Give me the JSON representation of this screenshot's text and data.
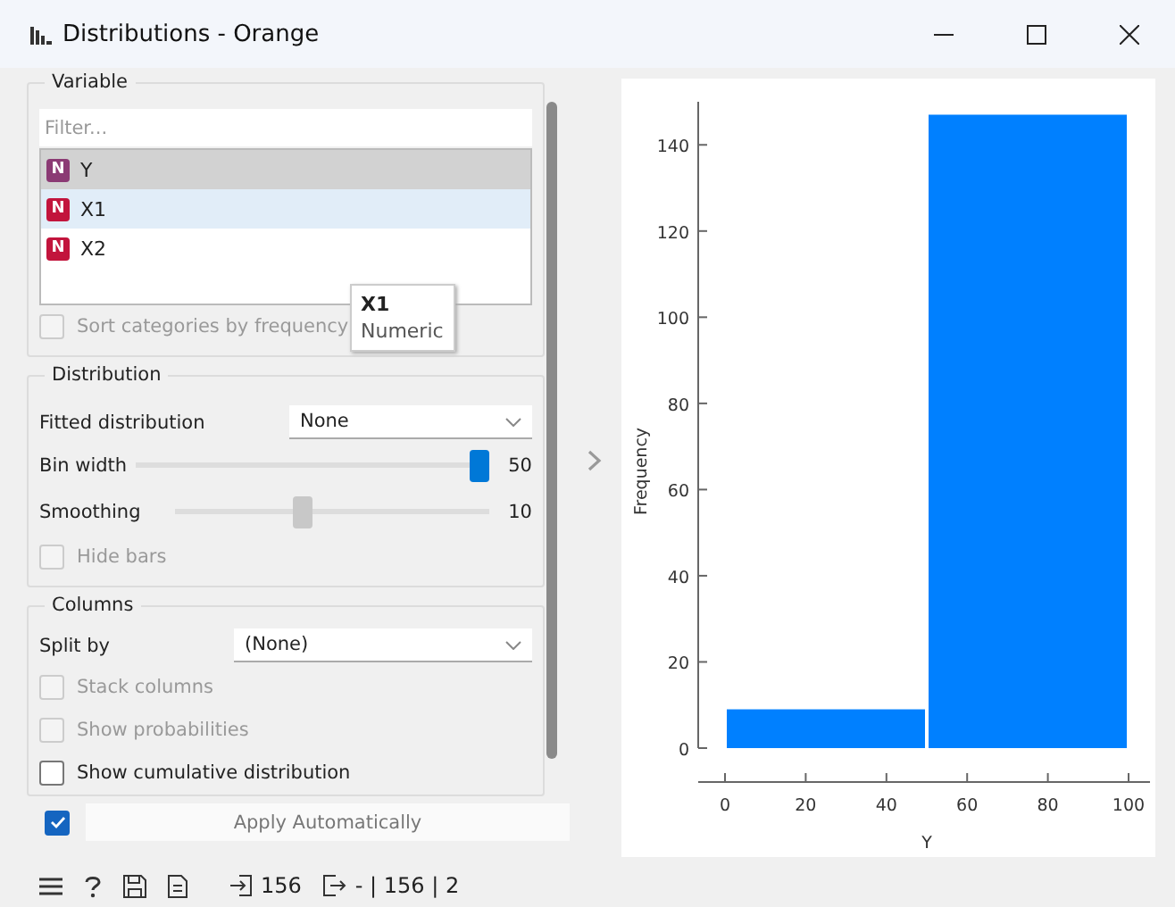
{
  "window": {
    "title": "Distributions - Orange"
  },
  "variable": {
    "title": "Variable",
    "filter": {
      "placeholder": "Filter..."
    },
    "items": [
      {
        "badge": "N",
        "name": "Y",
        "selected": true,
        "hovered": false,
        "color": "#8b3a74"
      },
      {
        "badge": "N",
        "name": "X1",
        "selected": false,
        "hovered": true,
        "color": "#c2143c"
      },
      {
        "badge": "N",
        "name": "X2",
        "selected": false,
        "hovered": false,
        "color": "#c2143c"
      }
    ],
    "tooltip": {
      "title": "X1",
      "subtitle": "Numeric"
    },
    "sort_checkbox": {
      "label": "Sort categories by frequency",
      "checked": false,
      "disabled": true
    }
  },
  "distribution": {
    "title": "Distribution",
    "fitted": {
      "label": "Fitted distribution",
      "value": "None"
    },
    "sliders": [
      {
        "label": "Bin width",
        "level": 1.0,
        "reading": "50",
        "active": true
      },
      {
        "label": "Smoothing",
        "level": 0.4,
        "reading": "10",
        "active": false
      }
    ],
    "hide_bars": {
      "label": "Hide bars",
      "checked": false,
      "disabled": true
    }
  },
  "columns": {
    "title": "Columns",
    "split_by": {
      "label": "Split by",
      "value": "(None)"
    },
    "checkboxes": [
      {
        "label": "Stack columns",
        "checked": false,
        "disabled": true
      },
      {
        "label": "Show probabilities",
        "checked": false,
        "disabled": true
      },
      {
        "label": "Show cumulative distribution",
        "checked": false,
        "disabled": false
      }
    ]
  },
  "apply": {
    "checked": true,
    "label": "Apply Automatically"
  },
  "chart": {
    "chart_data": {
      "type": "bar",
      "xlabel": "Y",
      "ylabel": "Frequency",
      "x": [
        25,
        75
      ],
      "values": [
        9,
        147
      ],
      "xlim": [
        0,
        100
      ],
      "ylim": [
        0,
        150
      ],
      "xticks": [
        0,
        20,
        40,
        60,
        80,
        100
      ],
      "yticks": [
        0,
        20,
        40,
        60,
        80,
        100,
        120,
        140
      ]
    }
  },
  "status_bar": {
    "input_count": "156",
    "output_text": "- | 156 | 2"
  }
}
